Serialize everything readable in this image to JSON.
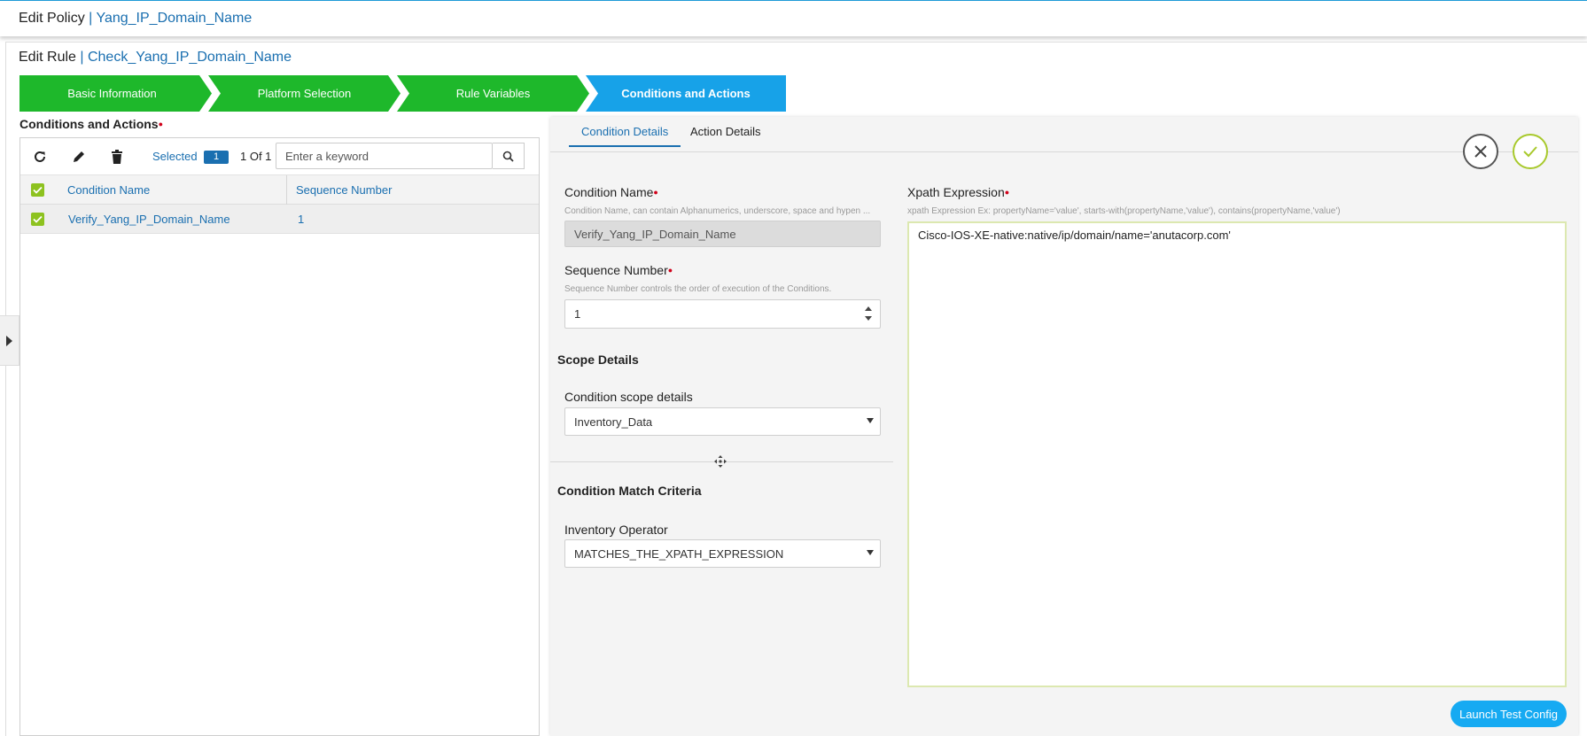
{
  "header": {
    "prefix": "Edit Policy",
    "sep": " | ",
    "policy_name": "Yang_IP_Domain_Name"
  },
  "rule": {
    "prefix": "Edit Rule",
    "sep": " | ",
    "rule_name": "Check_Yang_IP_Domain_Name"
  },
  "wizard": {
    "steps": [
      {
        "label": "Basic Information",
        "state": "complete",
        "color": "#1eb82b"
      },
      {
        "label": "Platform Selection",
        "state": "complete",
        "color": "#1eb82b"
      },
      {
        "label": "Rule Variables",
        "state": "complete",
        "color": "#1eb82b"
      },
      {
        "label": "Conditions and Actions",
        "state": "active",
        "color": "#17a2e8"
      }
    ]
  },
  "left": {
    "title": "Conditions and Actions",
    "toolbar": {
      "refresh_icon": "refresh-icon",
      "edit_icon": "pencil-icon",
      "delete_icon": "trash-icon",
      "selected_label": "Selected",
      "selected_count": "1",
      "pager": "1 Of 1",
      "search_placeholder": "Enter a keyword",
      "search_icon": "search-icon"
    },
    "table": {
      "columns": [
        "Condition Name",
        "Sequence Number"
      ],
      "rows": [
        {
          "name": "Verify_Yang_IP_Domain_Name",
          "sequence": "1",
          "checked": true
        }
      ]
    }
  },
  "right": {
    "tabs": [
      {
        "label": "Condition Details",
        "active": true
      },
      {
        "label": "Action Details",
        "active": false
      }
    ],
    "condition_name": {
      "label": "Condition Name",
      "hint": "Condition Name, can contain Alphanumerics, underscore, space and hypen ...",
      "value": "Verify_Yang_IP_Domain_Name"
    },
    "sequence_number": {
      "label": "Sequence Number",
      "hint": "Sequence Number controls the order of execution of the Conditions.",
      "value": "1"
    },
    "scope": {
      "section": "Scope Details",
      "label": "Condition scope details",
      "value": "Inventory_Data"
    },
    "match": {
      "section": "Condition Match Criteria",
      "label": "Inventory Operator",
      "value": "MATCHES_THE_XPATH_EXPRESSION"
    },
    "xpath": {
      "label": "Xpath Expression",
      "hint": "xpath Expression Ex: propertyName='value', starts-with(propertyName,'value'), contains(propertyName,'value')",
      "value": "Cisco-IOS-XE-native:native/ip/domain/name='anutacorp.com'"
    },
    "launch_button": "Launch Test Config",
    "accent_ok": "#a8c92c"
  }
}
